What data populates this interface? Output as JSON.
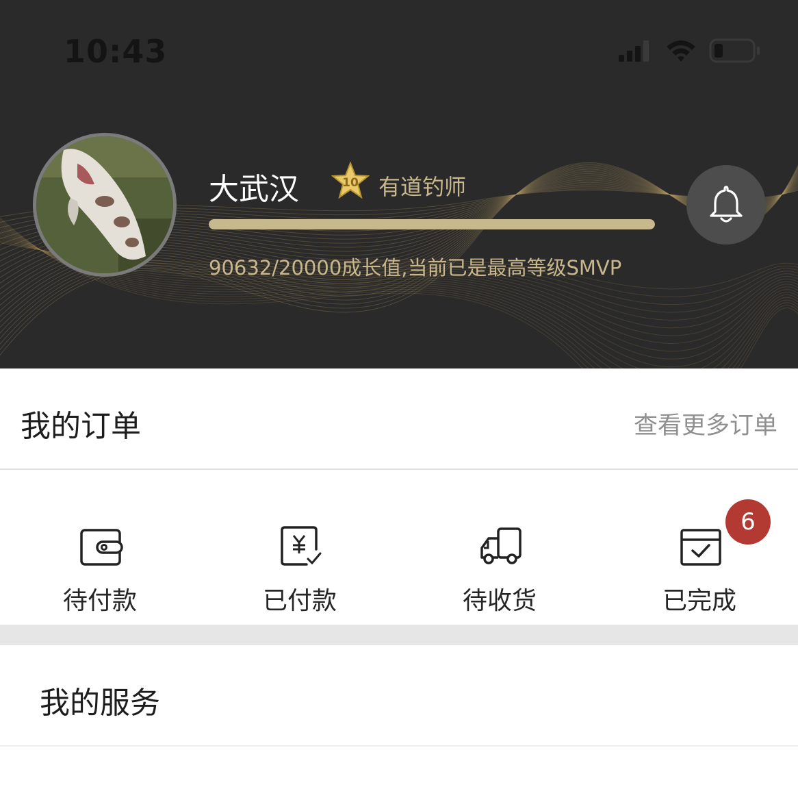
{
  "status_bar": {
    "time": "10:43",
    "icons": [
      "signal-icon",
      "wifi-icon",
      "battery-icon"
    ]
  },
  "profile": {
    "username": "大武汉",
    "level_badge": "10",
    "level_title": "有道钓师",
    "growth_progress": 1.0,
    "growth_text": "90632/20000成长值,当前已是最高等级SMVP",
    "avatar": "avatar",
    "notification_icon": "bell-icon"
  },
  "orders": {
    "title": "我的订单",
    "more_link": "查看更多订单",
    "items": [
      {
        "label": "待付款",
        "icon": "wallet-icon"
      },
      {
        "label": "已付款",
        "icon": "paid-receipt-icon"
      },
      {
        "label": "待收货",
        "icon": "delivery-truck-icon"
      },
      {
        "label": "已完成",
        "icon": "completed-check-icon",
        "badge": "6"
      }
    ]
  },
  "services": {
    "title": "我的服务"
  },
  "colors": {
    "header_bg": "#2a2a2a",
    "gold_accent": "#c8b88e",
    "badge_red": "#b23a33"
  }
}
